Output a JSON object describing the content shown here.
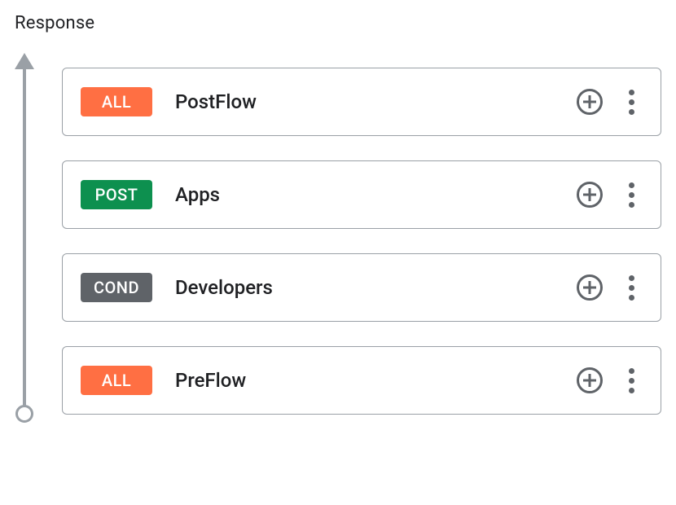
{
  "section": {
    "title": "Response"
  },
  "flows": [
    {
      "badge_text": "ALL",
      "badge_variant": "orange",
      "name": "PostFlow"
    },
    {
      "badge_text": "POST",
      "badge_variant": "green",
      "name": "Apps"
    },
    {
      "badge_text": "COND",
      "badge_variant": "gray",
      "name": "Developers"
    },
    {
      "badge_text": "ALL",
      "badge_variant": "orange",
      "name": "PreFlow"
    }
  ]
}
